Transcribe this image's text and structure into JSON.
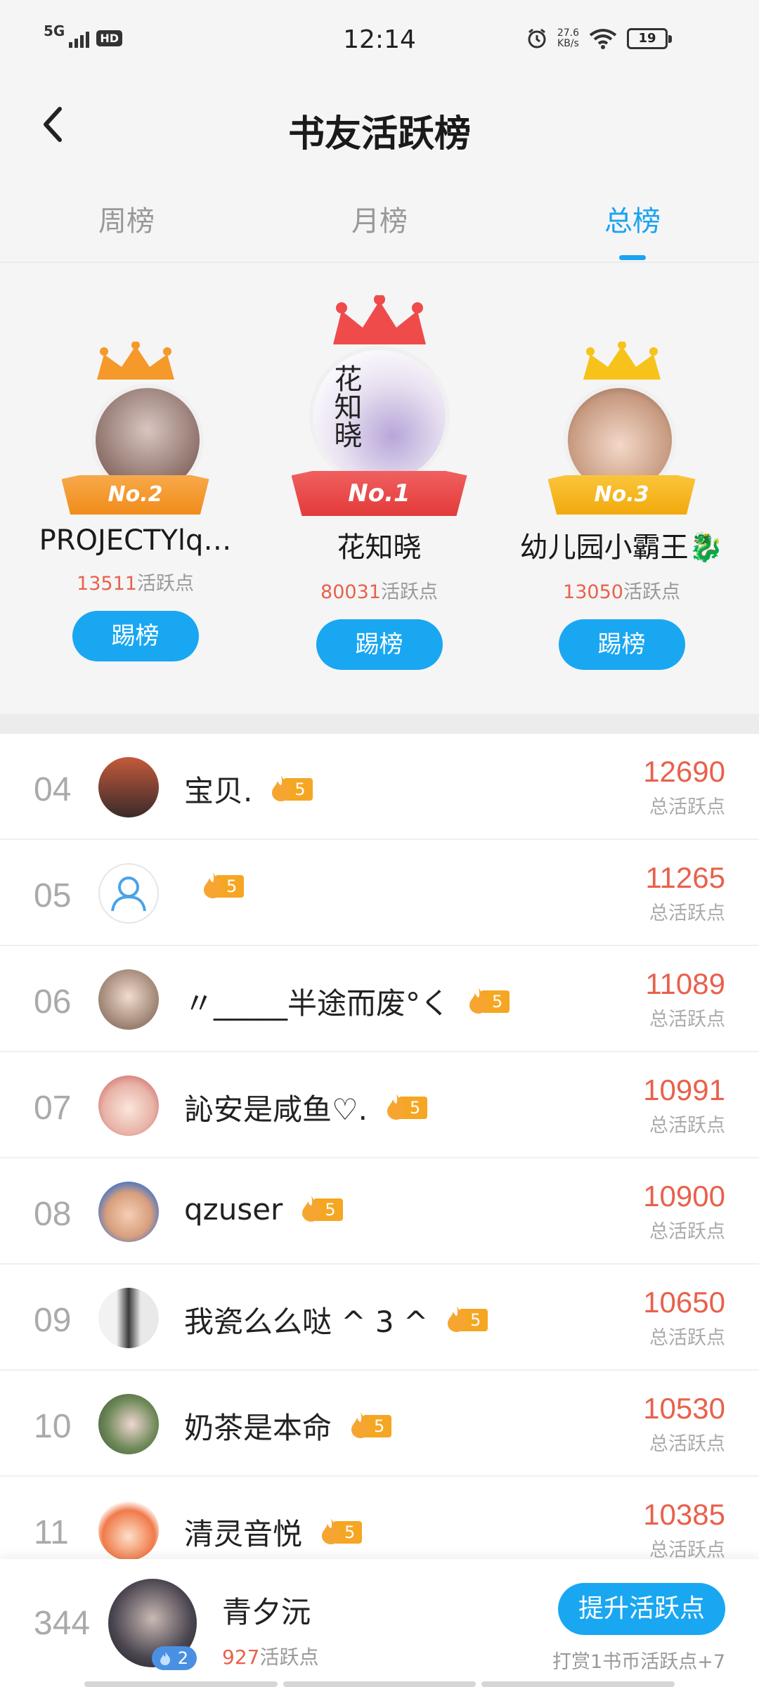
{
  "status_bar": {
    "network": "5G",
    "hd": "HD",
    "time": "12:14",
    "speed_value": "27.6",
    "speed_unit": "KB/s",
    "battery": "19"
  },
  "header": {
    "title": "书友活跃榜"
  },
  "tabs": [
    {
      "label": "周榜",
      "active": false
    },
    {
      "label": "月榜",
      "active": false
    },
    {
      "label": "总榜",
      "active": true
    }
  ],
  "podium": {
    "second": {
      "rank_label": "No.2",
      "name": "PROJECTYlq…",
      "points": "13511",
      "points_suffix": "活跃点",
      "button": "踢榜",
      "crown_color": "#f5992a",
      "ribbon_color": "#f5992a"
    },
    "first": {
      "rank_label": "No.1",
      "name": "花知晓",
      "points": "80031",
      "points_suffix": "活跃点",
      "button": "踢榜",
      "crown_color": "#ef4b4b",
      "ribbon_color": "#ef4b4b"
    },
    "third": {
      "rank_label": "No.3",
      "name": "幼儿园小霸王🐉",
      "points": "13050",
      "points_suffix": "活跃点",
      "button": "踢榜",
      "crown_color": "#f7c21a",
      "ribbon_color": "#f7b219"
    }
  },
  "list": [
    {
      "rank": "04",
      "name": "宝贝.",
      "level": "5",
      "score": "12690",
      "score_label": "总活跃点"
    },
    {
      "rank": "05",
      "name": "",
      "level": "5",
      "score": "11265",
      "score_label": "总活跃点"
    },
    {
      "rank": "06",
      "name": "〃_____半途而废°く",
      "level": "5",
      "score": "11089",
      "score_label": "总活跃点"
    },
    {
      "rank": "07",
      "name": "訫安是咸鱼♡.",
      "level": "5",
      "score": "10991",
      "score_label": "总活跃点"
    },
    {
      "rank": "08",
      "name": "qzuser",
      "level": "5",
      "score": "10900",
      "score_label": "总活跃点"
    },
    {
      "rank": "09",
      "name": "我瓷么么哒 ^ 3 ^",
      "level": "5",
      "score": "10650",
      "score_label": "总活跃点"
    },
    {
      "rank": "10",
      "name": "奶茶是本命",
      "level": "5",
      "score": "10530",
      "score_label": "总活跃点"
    },
    {
      "rank": "11",
      "name": "清灵音悦",
      "level": "5",
      "score": "10385",
      "score_label": "总活跃点"
    }
  ],
  "me": {
    "rank": "344",
    "name": "青夕沅",
    "level": "2",
    "points": "927",
    "points_suffix": "活跃点",
    "boost_button": "提升活跃点",
    "hint": "打赏1书币活跃点+7"
  },
  "colors": {
    "accent": "#19a7f2",
    "score": "#e8614c",
    "badge": "#f5a623"
  }
}
